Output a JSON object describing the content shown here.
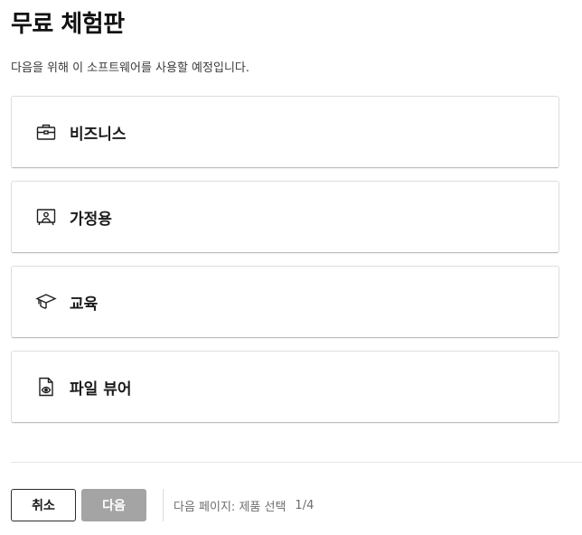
{
  "header": {
    "title": "무료 체험판",
    "subtitle": "다음을 위해 이 소프트웨어를 사용할 예정입니다."
  },
  "options": [
    {
      "label": "비즈니스",
      "icon": "briefcase-icon"
    },
    {
      "label": "가정용",
      "icon": "home-presentation-icon"
    },
    {
      "label": "교육",
      "icon": "graduation-cap-icon"
    },
    {
      "label": "파일 뷰어",
      "icon": "file-view-icon"
    }
  ],
  "footer": {
    "cancel_label": "취소",
    "next_label": "다음",
    "next_page_text": "다음 페이지: 제품 선택",
    "step_text": "1/4"
  },
  "colors": {
    "next_button_disabled": "#a4a4a4",
    "card_border": "#dedede",
    "text_primary": "#1b1b1b",
    "text_muted": "#6e6e6e"
  }
}
